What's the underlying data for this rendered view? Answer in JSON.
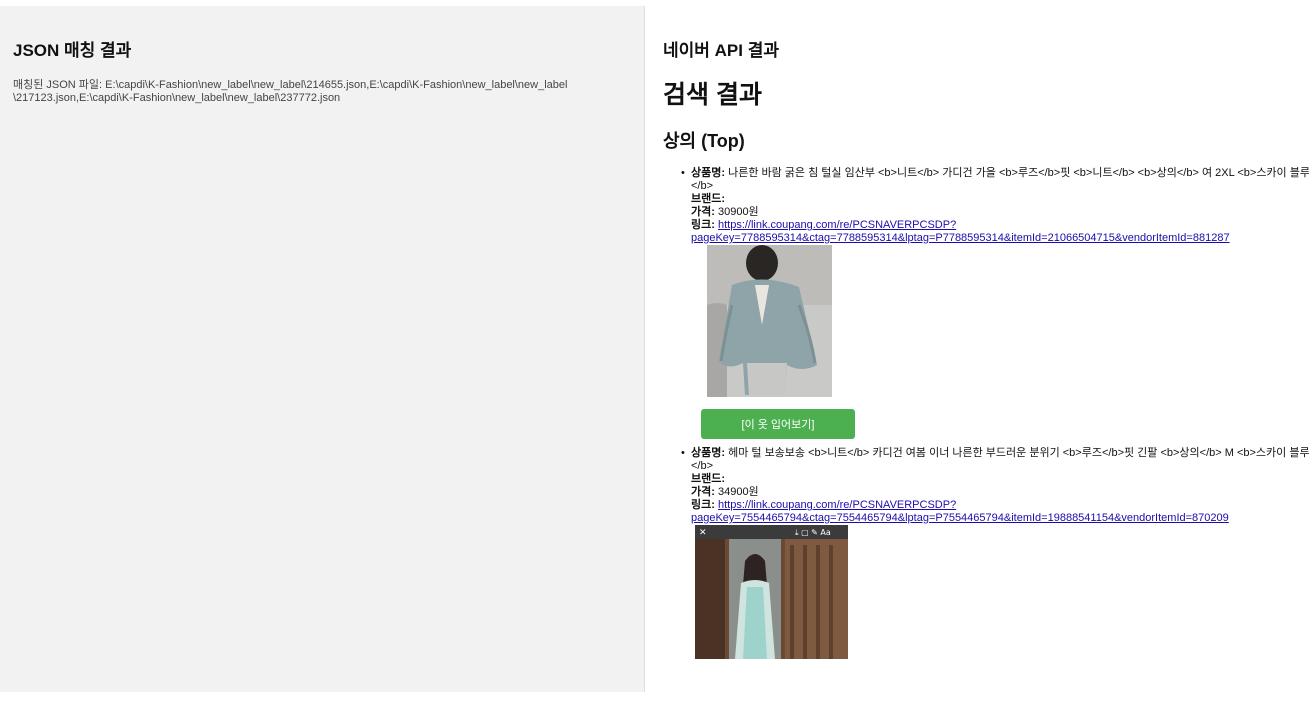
{
  "json_panel": {
    "title": "JSON 매칭 결과",
    "matched_label": "매칭된 JSON 파일:",
    "matched_files": "E:\\capdi\\K-Fashion\\new_label\\new_label\\214655.json,E:\\capdi\\K-Fashion\\new_label\\new_label\\217123.json,E:\\capdi\\K-Fashion\\new_label\\new_label\\237772.json"
  },
  "api_panel": {
    "title": "네이버 API 결과",
    "search_title": "검색 결과",
    "category_title": "상의 (Top)",
    "labels": {
      "name": "상품명:",
      "brand": "브랜드:",
      "price": "가격:",
      "link": "링크:"
    },
    "products": [
      {
        "name": "나른한 바람 굵은 침 털실 임산부 <b>니트</b> 가디건 가을 <b>루즈</b>핏 <b>니트</b> <b>상의</b> 여 2XL <b>스카이 블루</b>",
        "brand": "",
        "price": "30900원",
        "link_line1": "https://link.coupang.com/re/PCSNAVERPCSDP?",
        "link_line2": "pageKey=7788595314&ctag=7788595314&lptag=P7788595314&itemId=21066504715&vendorItemId=881287",
        "button_label": "[이 옷 입어보기]",
        "image": "cardigan-photo"
      },
      {
        "name": "헤마 털 보송보송 <b>니트</b> 카디건 여봄 이너 나른한 부드러운 분위기 <b>루즈</b>핏 긴팔 <b>상의</b> M <b>스카이 블루</b>",
        "brand": "",
        "price": "34900원",
        "link_line1": "https://link.coupang.com/re/PCSNAVERPCSDP?",
        "link_line2": "pageKey=7554465794&ctag=7554465794&lptag=P7554465794&itemId=19888541154&vendorItemId=870209",
        "image": "model-photo"
      }
    ]
  },
  "colors": {
    "button_green": "#4caf50",
    "link_blue": "#1a0dab",
    "left_bg": "#f2f2f2"
  }
}
